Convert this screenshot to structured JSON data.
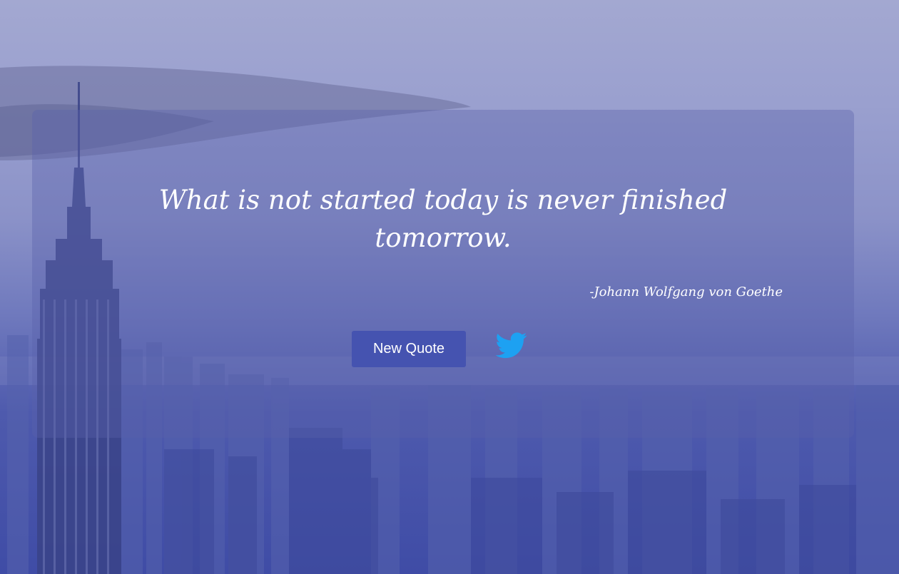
{
  "quote": {
    "text": "What is not started today is never finished tomorrow.",
    "author": "-Johann Wolfgang von Goethe"
  },
  "actions": {
    "new_quote_label": "New Quote",
    "tweet_icon": "twitter-bird-icon"
  },
  "colors": {
    "background_top": "#a3a8d1",
    "background_bottom": "#3f4ca6",
    "card": "#5a62aa",
    "button": "#4553b0",
    "twitter_blue": "#1da1f2",
    "text": "#ffffff"
  }
}
